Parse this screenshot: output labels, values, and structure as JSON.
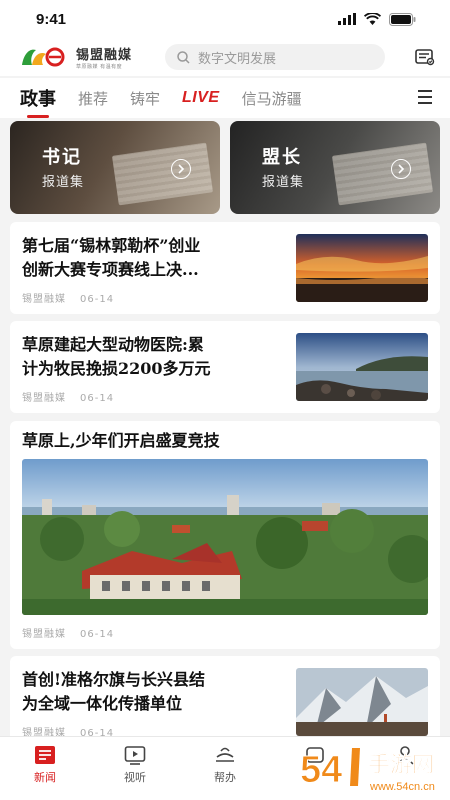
{
  "status": {
    "time": "9:41"
  },
  "header": {
    "logo_name": "锡盟融媒",
    "logo_tag": "草原融媒 有温有度",
    "search_placeholder": "数字文明发展"
  },
  "tabs": [
    {
      "label": "政事",
      "active": true
    },
    {
      "label": "推荐"
    },
    {
      "label": "铸牢"
    },
    {
      "label": "LIVE"
    },
    {
      "label": "信马游疆"
    }
  ],
  "feature_cards": [
    {
      "title": "书记",
      "subtitle": "报道集"
    },
    {
      "title": "盟长",
      "subtitle": "报道集"
    }
  ],
  "news": [
    {
      "title_line1": "第七届“锡林郭勒杯”创业",
      "title_line2": "创新大赛专项赛线上决...",
      "source": "锡盟融媒",
      "date": "06-14"
    },
    {
      "title_line1": "草原建起大型动物医院:累",
      "title_line2": "计为牧民挽损2200多万元",
      "source": "锡盟融媒",
      "date": "06-14"
    },
    {
      "title_line1": "草原上,少年们开启盛夏竞技",
      "source": "锡盟融媒",
      "date": "06-14"
    },
    {
      "title_line1": "首创!准格尔旗与长兴县结",
      "title_line2": "为全域一体化传播单位",
      "source": "锡盟融媒",
      "date": "06-14"
    }
  ],
  "bottom_nav": [
    {
      "label": "新闻",
      "active": true
    },
    {
      "label": "视听"
    },
    {
      "label": "帮办"
    },
    {
      "label": ""
    },
    {
      "label": ""
    }
  ],
  "watermark": {
    "text": "手游网",
    "digits": "54",
    "domain": "www.54cn.cn"
  },
  "colors": {
    "accent": "#d82020",
    "text": "#111111",
    "muted": "#9a9a9a"
  }
}
